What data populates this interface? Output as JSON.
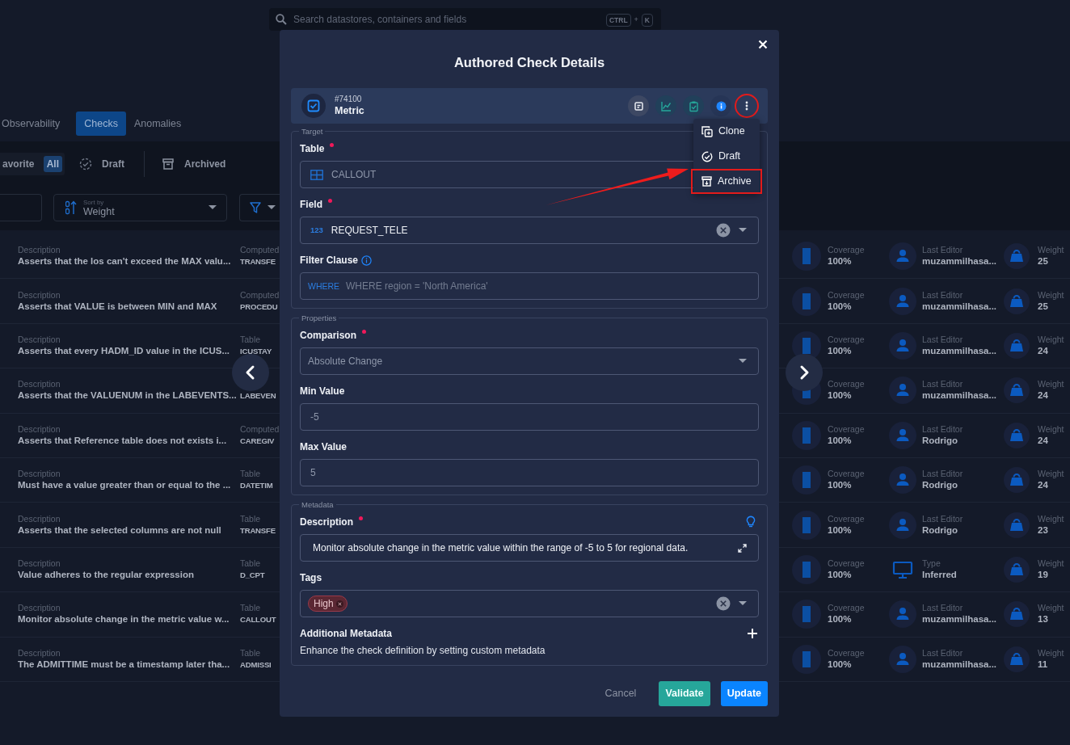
{
  "search": {
    "placeholder": "Search datastores, containers and fields",
    "shortcut": [
      "CTRL",
      "+",
      "K"
    ]
  },
  "tabs": [
    {
      "label": "Observability",
      "selected": false
    },
    {
      "label": "Checks",
      "selected": true
    },
    {
      "label": "Anomalies",
      "selected": false
    }
  ],
  "favorite_toggle": [
    {
      "label": "avorite",
      "selected": false
    },
    {
      "label": "All",
      "selected": true
    }
  ],
  "status_filters": [
    {
      "label": "Draft",
      "kind": "draft"
    },
    {
      "label": "Archived",
      "kind": "archived"
    }
  ],
  "sort": {
    "label": "Sort by",
    "value": "Weight"
  },
  "checks": [
    {
      "kind": "editor",
      "description_label": "Description",
      "description": "Asserts that the los can't exceed the MAX valu...",
      "column_2_label": "Computed",
      "column_2": "TRANSFE",
      "coverage_label": "Coverage",
      "coverage": "100%",
      "info_label": "Last Editor",
      "info": "muzammilhasa...",
      "weight_label": "Weight",
      "weight": "25"
    },
    {
      "kind": "editor",
      "description_label": "Description",
      "description": "Asserts that VALUE is between MIN and MAX",
      "column_2_label": "Computed",
      "column_2": "PROCEDU",
      "coverage_label": "Coverage",
      "coverage": "100%",
      "info_label": "Last Editor",
      "info": "muzammilhasa...",
      "weight_label": "Weight",
      "weight": "25"
    },
    {
      "kind": "editor",
      "description_label": "Description",
      "description": "Asserts that every HADM_ID value in the ICUS...",
      "column_2_label": "Table",
      "column_2": "ICUSTAY",
      "coverage_label": "Coverage",
      "coverage": "100%",
      "info_label": "Last Editor",
      "info": "muzammilhasa...",
      "weight_label": "Weight",
      "weight": "24"
    },
    {
      "kind": "editor",
      "description_label": "Description",
      "description": "Asserts that the VALUENUM in the LABEVENTS...",
      "column_2": "LABEVEN",
      "coverage_label": "Coverage",
      "coverage": "100%",
      "info_label": "Last Editor",
      "info": "muzammilhasa...",
      "weight_label": "Weight",
      "weight": "24"
    },
    {
      "kind": "editor",
      "description_label": "Description",
      "description": "Asserts that Reference table does not exists i...",
      "column_2_label": "Computed",
      "column_2": "CAREGIV",
      "coverage_label": "Coverage",
      "coverage": "100%",
      "info_label": "Last Editor",
      "info": "Rodrigo",
      "weight_label": "Weight",
      "weight": "24"
    },
    {
      "kind": "editor",
      "description_label": "Description",
      "description": "Must have a value greater than or equal to the ...",
      "column_2_label": "Table",
      "column_2": "DATETIM",
      "coverage_label": "Coverage",
      "coverage": "100%",
      "info_label": "Last Editor",
      "info": "Rodrigo",
      "weight_label": "Weight",
      "weight": "24"
    },
    {
      "kind": "editor",
      "description_label": "Description",
      "description": "Asserts that the selected columns are not null",
      "column_2_label": "Table",
      "column_2": "TRANSFE",
      "coverage_label": "Coverage",
      "coverage": "100%",
      "info_label": "Last Editor",
      "info": "Rodrigo",
      "weight_label": "Weight",
      "weight": "23"
    },
    {
      "kind": "type",
      "description_label": "Description",
      "description": "Value adheres to the regular expression",
      "column_2_label": "Table",
      "column_2": "D_CPT",
      "coverage_label": "Coverage",
      "coverage": "100%",
      "info_label": "Type",
      "info": "Inferred",
      "weight_label": "Weight",
      "weight": "19"
    },
    {
      "kind": "editor",
      "description_label": "Description",
      "description": "Monitor absolute change in the metric value w...",
      "column_2_label": "Table",
      "column_2": "CALLOUT",
      "coverage_label": "Coverage",
      "coverage": "100%",
      "info_label": "Last Editor",
      "info": "muzammilhasa...",
      "weight_label": "Weight",
      "weight": "13"
    },
    {
      "kind": "editor",
      "description_label": "Description",
      "description": "The ADMITTIME must be a timestamp later tha...",
      "column_2_label": "Table",
      "column_2": "ADMISSI",
      "coverage_label": "Coverage",
      "coverage": "100%",
      "info_label": "Last Editor",
      "info": "muzammilhasa...",
      "weight_label": "Weight",
      "weight": "11"
    }
  ],
  "modal": {
    "title": "Authored Check Details",
    "check_id": "#74100",
    "check_type": "Metric",
    "more_highlighted": true,
    "menu": [
      {
        "kind": "clone",
        "label": "Clone",
        "highlighted": false
      },
      {
        "kind": "draft",
        "label": "Draft",
        "highlighted": false
      },
      {
        "kind": "archive",
        "label": "Archive",
        "highlighted": true
      }
    ],
    "sections": [
      {
        "legend": "Target",
        "fields": [
          {
            "kind": "table",
            "label": "Table",
            "required": true,
            "disabled": true,
            "value": "CALLOUT"
          },
          {
            "kind": "column",
            "label": "Field",
            "required": true,
            "disabled": false,
            "type_badge": "123",
            "value": "REQUEST_TELE"
          },
          {
            "kind": "filter",
            "label": "Filter Clause",
            "required": false,
            "disabled": false,
            "prefix": "WHERE",
            "placeholder": "WHERE region = 'North America'"
          }
        ]
      },
      {
        "legend": "Properties",
        "fields": [
          {
            "kind": "select",
            "label": "Comparison",
            "required": true,
            "disabled": true,
            "value": "Absolute Change"
          },
          {
            "kind": "input",
            "label": "Min Value",
            "required": false,
            "disabled": true,
            "value": "-5"
          },
          {
            "kind": "input",
            "label": "Max Value",
            "required": false,
            "disabled": true,
            "value": "5"
          }
        ]
      },
      {
        "legend": "Metadata",
        "fields": [
          {
            "kind": "textarea",
            "label": "Description",
            "required": true,
            "disabled": false,
            "value": "Monitor absolute change in the metric value within the range of -5 to 5 for regional data."
          },
          {
            "kind": "tags",
            "label": "Tags",
            "required": false,
            "disabled": false,
            "tags": [
              "High"
            ]
          },
          {
            "kind": "metadata",
            "label": "Additional Metadata",
            "required": false,
            "disabled": false,
            "text": "Enhance the check definition by setting custom metadata"
          }
        ]
      }
    ],
    "buttons": [
      {
        "kind": "cancel",
        "label": "Cancel"
      },
      {
        "kind": "validate",
        "label": "Validate"
      },
      {
        "kind": "update",
        "label": "Update"
      }
    ]
  }
}
